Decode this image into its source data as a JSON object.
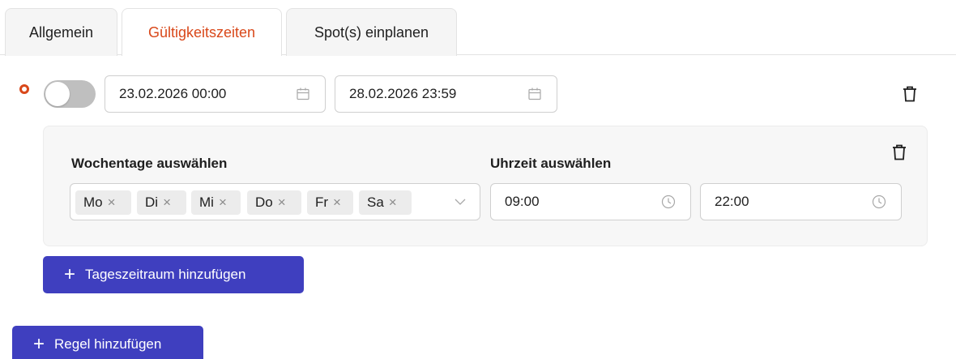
{
  "tabs": [
    {
      "label": "Allgemein",
      "active": false
    },
    {
      "label": "Gültigkeitszeiten",
      "active": true
    },
    {
      "label": "Spot(s) einplanen",
      "active": false
    }
  ],
  "colors": {
    "accent": "#d9481a",
    "primary_button": "#3f3fbf",
    "toggle_off": "#bfbfbf",
    "panel_bg": "#f7f7f7"
  },
  "rule": {
    "toggle_on": false,
    "start_date": "23.02.2026 00:00",
    "end_date": "28.02.2026 23:59",
    "start_icon": "calendar-icon",
    "end_icon": "calendar-icon",
    "delete_icon": "trash-icon"
  },
  "period": {
    "weekdays_label": "Wochentage auswählen",
    "time_label": "Uhrzeit auswählen",
    "weekdays": [
      "Mo",
      "Di",
      "Mi",
      "Do",
      "Fr",
      "Sa"
    ],
    "chip_remove": "×",
    "time_from": "09:00",
    "time_to": "22:00",
    "time_icon": "clock-icon",
    "delete_icon": "trash-icon"
  },
  "buttons": {
    "plus": "+",
    "add_period": "Tageszeitraum hinzufügen",
    "add_rule": "Regel hinzufügen"
  }
}
